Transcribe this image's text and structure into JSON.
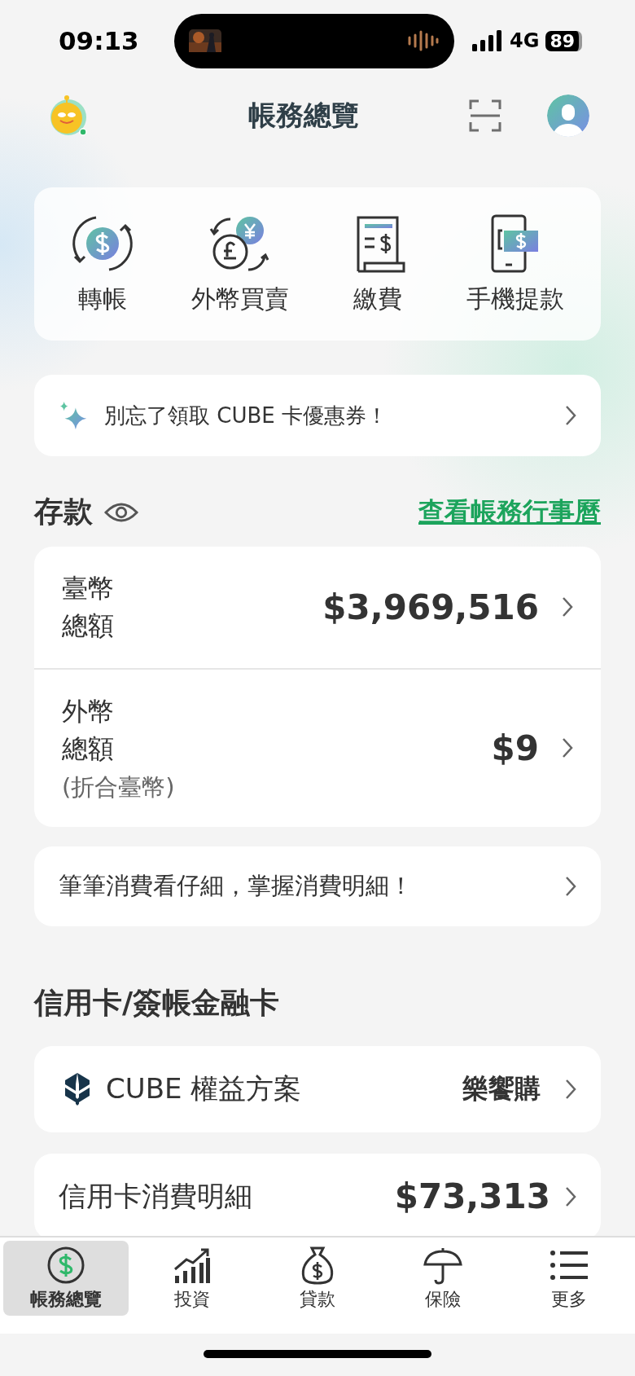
{
  "status_bar": {
    "time": "09:13",
    "network": "4G",
    "battery": "89"
  },
  "header": {
    "title": "帳務總覽"
  },
  "quick_actions": [
    {
      "label": "轉帳",
      "kind": "transfer"
    },
    {
      "label": "外幣買賣",
      "kind": "exchange"
    },
    {
      "label": "繳費",
      "kind": "bill"
    },
    {
      "label": "手機提款",
      "kind": "phone"
    }
  ],
  "promo_banner": {
    "text": "別忘了領取 CUBE 卡優惠券！"
  },
  "deposits": {
    "title": "存款",
    "link": "查看帳務行事曆",
    "rows": [
      {
        "label": "臺幣總額",
        "amount": "$3,969,516"
      },
      {
        "label": "外幣總額",
        "note": "(折合臺幣)",
        "amount": "$9"
      }
    ]
  },
  "spending_banner": {
    "text": "筆筆消費看仔細，掌握消費明細！"
  },
  "cards": {
    "title": "信用卡/簽帳金融卡",
    "plan": {
      "label": "CUBE 權益方案",
      "value": "樂饗購"
    },
    "statement": {
      "label": "信用卡消費明細",
      "amount": "$73,313"
    }
  },
  "tab_bar": [
    {
      "label": "帳務總覽",
      "kind": "overview",
      "selected": true
    },
    {
      "label": "投資",
      "kind": "invest",
      "selected": false
    },
    {
      "label": "貸款",
      "kind": "loan",
      "selected": false
    },
    {
      "label": "保險",
      "kind": "insurance",
      "selected": false
    },
    {
      "label": "更多",
      "kind": "more",
      "selected": false
    }
  ]
}
